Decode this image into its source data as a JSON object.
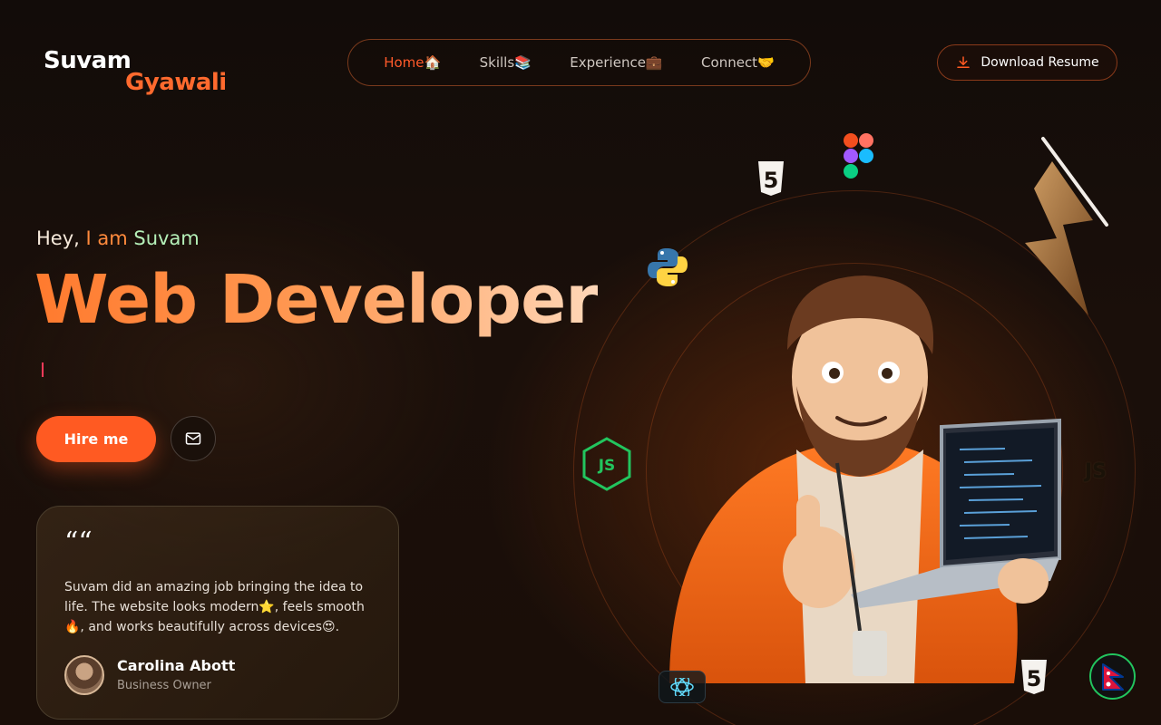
{
  "logo": {
    "first": "Suvam",
    "last": "Gyawali"
  },
  "nav": {
    "items": [
      {
        "label": "Home🏠",
        "active": true
      },
      {
        "label": "Skills📚",
        "active": false
      },
      {
        "label": "Experience💼",
        "active": false
      },
      {
        "label": "Connect🤝",
        "active": false
      }
    ]
  },
  "download_button": {
    "label": "Download Resume",
    "icon": "download-icon"
  },
  "hero": {
    "greeting_part1": "Hey,",
    "greeting_part2": " I am ",
    "greeting_part3": "Suvam",
    "headline": "Web Developer",
    "hire_label": "Hire me",
    "mail_icon": "mail-icon"
  },
  "testimonial": {
    "quote_mark": "““",
    "text": "Suvam did an amazing job bringing the idea to life. The website looks modern⭐, feels smooth🔥, and works beautifully across devices😍.",
    "author": "Carolina Abott",
    "role": "Business Owner"
  },
  "tech_icons": {
    "html5": "5",
    "js_node": "JS",
    "js_plain": "JS",
    "figma": "figma-icon",
    "python": "python-icon",
    "react": "react-icon",
    "flag": "nepal-flag-icon"
  },
  "colors": {
    "accent": "#ff5a22",
    "accent_light": "#ff8a3c",
    "name_green": "#b5f0b8",
    "badge_green": "#22c55e"
  }
}
